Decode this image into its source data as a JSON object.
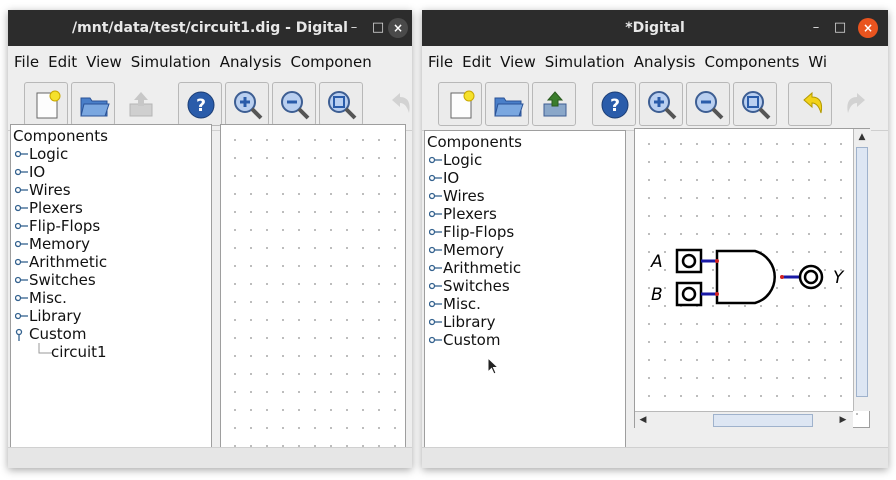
{
  "window1": {
    "title": "/mnt/data/test/circuit1.dig - Digital",
    "menu": [
      "File",
      "Edit",
      "View",
      "Simulation",
      "Analysis",
      "Componen"
    ],
    "toolbar": [
      "new-icon",
      "open-icon",
      "save-icon",
      "help-icon",
      "zoom-in-icon",
      "zoom-out-icon",
      "zoom-fit-icon",
      "undo-icon"
    ],
    "tree": {
      "root": "Components",
      "items": [
        "Logic",
        "IO",
        "Wires",
        "Plexers",
        "Flip-Flops",
        "Memory",
        "Arithmetic",
        "Switches",
        "Misc.",
        "Library",
        "Custom"
      ],
      "expanded_item": "Custom",
      "child": "circuit1"
    }
  },
  "window2": {
    "title": "*Digital",
    "menu": [
      "File",
      "Edit",
      "View",
      "Simulation",
      "Analysis",
      "Components",
      "Wi"
    ],
    "toolbar": [
      "new-icon",
      "open-icon",
      "save-icon",
      "help-icon",
      "zoom-in-icon",
      "zoom-out-icon",
      "zoom-fit-icon",
      "undo-icon",
      "redo-icon"
    ],
    "tree": {
      "root": "Components",
      "items": [
        "Logic",
        "IO",
        "Wires",
        "Plexers",
        "Flip-Flops",
        "Memory",
        "Arithmetic",
        "Switches",
        "Misc.",
        "Library",
        "Custom"
      ]
    },
    "circuit": {
      "input_a": "A",
      "input_b": "B",
      "output": "Y",
      "gate": "AND"
    }
  },
  "window_controls": {
    "minimize": "–",
    "maximize": "□",
    "close": "×"
  },
  "colors": {
    "titlebar": "#2c2c2c",
    "close_active": "#e9541f",
    "wire": "#1a1aa6",
    "pin": "#d02020",
    "toolbar_icon": "#2a5caa"
  }
}
